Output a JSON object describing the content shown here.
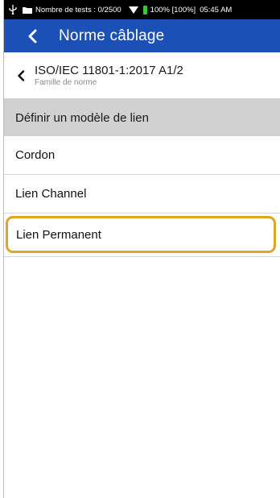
{
  "status_bar": {
    "tests_label": "Nombre de tests : 0/2500",
    "battery": "100% [100%]",
    "time": "05:45 AM"
  },
  "app_bar": {
    "title": "Norme câblage"
  },
  "breadcrumb": {
    "title": "ISO/IEC 11801-1:2017 A1/2",
    "subtitle": "Famille de norme"
  },
  "section_header": "Définir un modèle de lien",
  "items": [
    {
      "label": "Cordon"
    },
    {
      "label": "Lien Channel"
    },
    {
      "label": "Lien Permanent"
    }
  ],
  "colors": {
    "app_bar": "#1b50b6",
    "highlight": "#e0a524",
    "section": "#d1d1d1"
  }
}
